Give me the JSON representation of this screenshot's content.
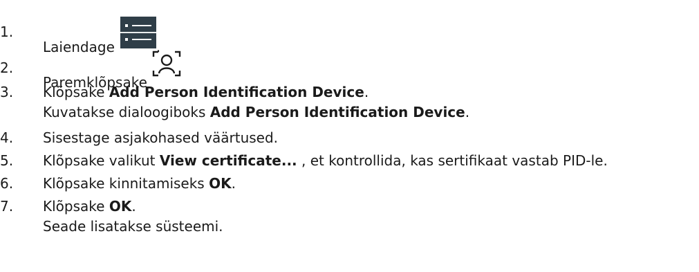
{
  "steps": [
    {
      "num": "1.",
      "text": "Laiendage",
      "suffix": ".",
      "icon": "device-list-icon"
    },
    {
      "num": "2.",
      "text": "Paremklõpsake",
      "icon": "person-identification-icon"
    },
    {
      "num": "3.",
      "pre": "Klõpsake ",
      "bold": "Add Person Identification Device",
      "post": ".",
      "result_pre": "Kuvatakse dialoogiboks ",
      "result_bold": "Add Person Identification Device",
      "result_post": "."
    },
    {
      "num": "4.",
      "text": "Sisestage asjakohased väärtused."
    },
    {
      "num": "5.",
      "pre": "Klõpsake valikut ",
      "bold": "View certificate...",
      "post": " , et kontrollida, kas sertifikaat vastab PID-le."
    },
    {
      "num": "6.",
      "pre": "Klõpsake kinnitamiseks ",
      "bold": "OK",
      "post": "."
    },
    {
      "num": "7.",
      "pre": "Klõpsake ",
      "bold": "OK",
      "post": ".",
      "result_text": "Seade lisatakse süsteemi."
    }
  ]
}
